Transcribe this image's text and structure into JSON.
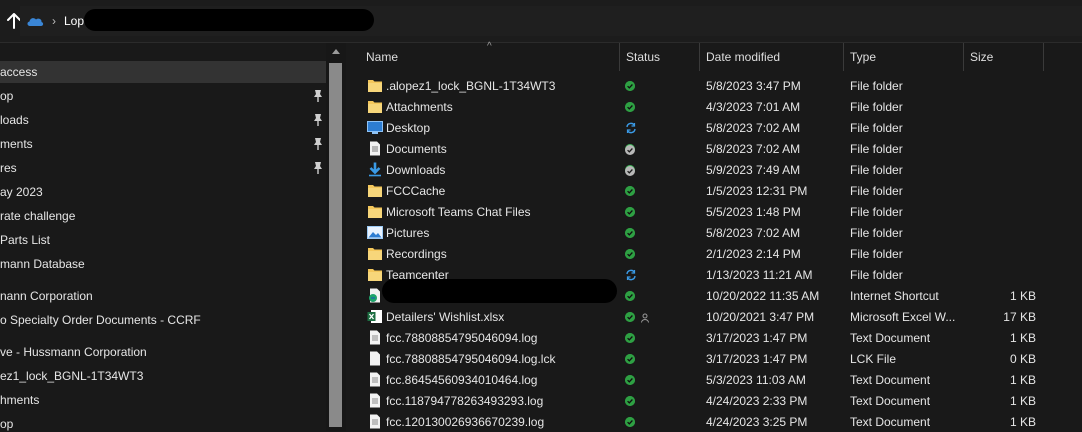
{
  "address": {
    "path_root": "Lopez"
  },
  "nav": {
    "items": [
      {
        "label": "access",
        "pinned": false,
        "selected": true
      },
      {
        "label": "op",
        "pinned": true,
        "selected": false
      },
      {
        "label": "loads",
        "pinned": true,
        "selected": false
      },
      {
        "label": "ments",
        "pinned": true,
        "selected": false
      },
      {
        "label": "res",
        "pinned": true,
        "selected": false
      },
      {
        "label": "ay 2023",
        "pinned": false,
        "selected": false
      },
      {
        "label": "rate challenge",
        "pinned": false,
        "selected": false
      },
      {
        "label": "Parts List",
        "pinned": false,
        "selected": false
      },
      {
        "label": "mann Database",
        "pinned": false,
        "selected": false
      },
      {
        "label": "nann Corporation",
        "pinned": false,
        "selected": false
      },
      {
        "label": "o Specialty Order Documents - CCRF",
        "pinned": false,
        "selected": false
      },
      {
        "label": "ve - Hussmann Corporation",
        "pinned": false,
        "selected": false
      },
      {
        "label": "ez1_lock_BGNL-1T34WT3",
        "pinned": false,
        "selected": false
      },
      {
        "label": "hments",
        "pinned": false,
        "selected": false
      },
      {
        "label": "op",
        "pinned": false,
        "selected": false
      }
    ]
  },
  "columns": {
    "name": "Name",
    "status": "Status",
    "date": "Date modified",
    "type": "Type",
    "size": "Size"
  },
  "files": [
    {
      "name": ".alopez1_lock_BGNL-1T34WT3",
      "icon": "folder-icon",
      "status": "synced",
      "date": "5/8/2023 3:47 PM",
      "type": "File folder",
      "size": ""
    },
    {
      "name": "Attachments",
      "icon": "folder-icon",
      "status": "synced",
      "date": "4/3/2023 7:01 AM",
      "type": "File folder",
      "size": ""
    },
    {
      "name": "Desktop",
      "icon": "desktop-icon",
      "status": "syncing",
      "date": "5/8/2023 7:02 AM",
      "type": "File folder",
      "size": ""
    },
    {
      "name": "Documents",
      "icon": "documents-icon",
      "status": "available",
      "date": "5/8/2023 7:02 AM",
      "type": "File folder",
      "size": ""
    },
    {
      "name": "Downloads",
      "icon": "downloads-icon",
      "status": "available",
      "date": "5/9/2023 7:49 AM",
      "type": "File folder",
      "size": ""
    },
    {
      "name": "FCCCache",
      "icon": "folder-icon",
      "status": "synced",
      "date": "1/5/2023 12:31 PM",
      "type": "File folder",
      "size": ""
    },
    {
      "name": "Microsoft Teams Chat Files",
      "icon": "folder-icon",
      "status": "synced",
      "date": "5/5/2023 1:48 PM",
      "type": "File folder",
      "size": ""
    },
    {
      "name": "Pictures",
      "icon": "pictures-icon",
      "status": "synced",
      "date": "5/8/2023 7:02 AM",
      "type": "File folder",
      "size": ""
    },
    {
      "name": "Recordings",
      "icon": "folder-icon",
      "status": "synced",
      "date": "2/1/2023 2:14 PM",
      "type": "File folder",
      "size": ""
    },
    {
      "name": "Teamcenter",
      "icon": "folder-icon",
      "status": "syncing",
      "date": "1/13/2023 11:21 AM",
      "type": "File folder",
      "size": ""
    },
    {
      "name": "",
      "icon": "internet-shortcut-icon",
      "status": "synced",
      "date": "10/20/2022 11:35 AM",
      "type": "Internet Shortcut",
      "size": "1 KB"
    },
    {
      "name": "Detailers' Wishlist.xlsx",
      "icon": "excel-icon",
      "status": "synced-shared",
      "date": "10/20/2021 3:47 PM",
      "type": "Microsoft Excel W...",
      "size": "17 KB"
    },
    {
      "name": "fcc.78808854795046094.log",
      "icon": "text-file-icon",
      "status": "synced",
      "date": "3/17/2023 1:47 PM",
      "type": "Text Document",
      "size": "1 KB"
    },
    {
      "name": "fcc.78808854795046094.log.lck",
      "icon": "blank-file-icon",
      "status": "synced",
      "date": "3/17/2023 1:47 PM",
      "type": "LCK File",
      "size": "0 KB"
    },
    {
      "name": "fcc.86454560934010464.log",
      "icon": "text-file-icon",
      "status": "synced",
      "date": "5/3/2023 11:03 AM",
      "type": "Text Document",
      "size": "1 KB"
    },
    {
      "name": "fcc.118794778263493293.log",
      "icon": "text-file-icon",
      "status": "synced",
      "date": "4/24/2023 2:33 PM",
      "type": "Text Document",
      "size": "1 KB"
    },
    {
      "name": "fcc.120130026936670239.log",
      "icon": "text-file-icon",
      "status": "synced",
      "date": "4/24/2023 3:25 PM",
      "type": "Text Document",
      "size": "1 KB"
    }
  ],
  "colors": {
    "accent": "#3a86d6",
    "status_green": "#2ea043",
    "folder_yellow": "#f4c75b"
  }
}
